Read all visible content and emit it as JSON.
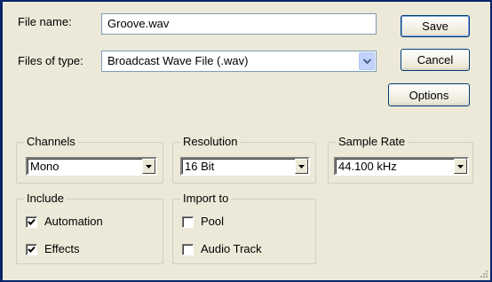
{
  "file_name": {
    "label": "File name:",
    "value": "Groove.wav"
  },
  "files_of_type": {
    "label": "Files of type:",
    "value": "Broadcast Wave File (.wav)"
  },
  "buttons": {
    "save": "Save",
    "cancel": "Cancel",
    "options": "Options"
  },
  "channels": {
    "title": "Channels",
    "value": "Mono"
  },
  "resolution": {
    "title": "Resolution",
    "value": "16 Bit"
  },
  "sample_rate": {
    "title": "Sample Rate",
    "value": "44.100 kHz"
  },
  "include": {
    "title": "Include",
    "automation": {
      "label": "Automation",
      "checked": true
    },
    "effects": {
      "label": "Effects",
      "checked": true
    }
  },
  "import_to": {
    "title": "Import to",
    "pool": {
      "label": "Pool",
      "checked": false
    },
    "audio_track": {
      "label": "Audio Track",
      "checked": false
    }
  },
  "colors": {
    "dialog_bg": "#ece9d8",
    "frame": "#0a246a",
    "field_border": "#7f9db9",
    "button_border": "#003c74"
  }
}
